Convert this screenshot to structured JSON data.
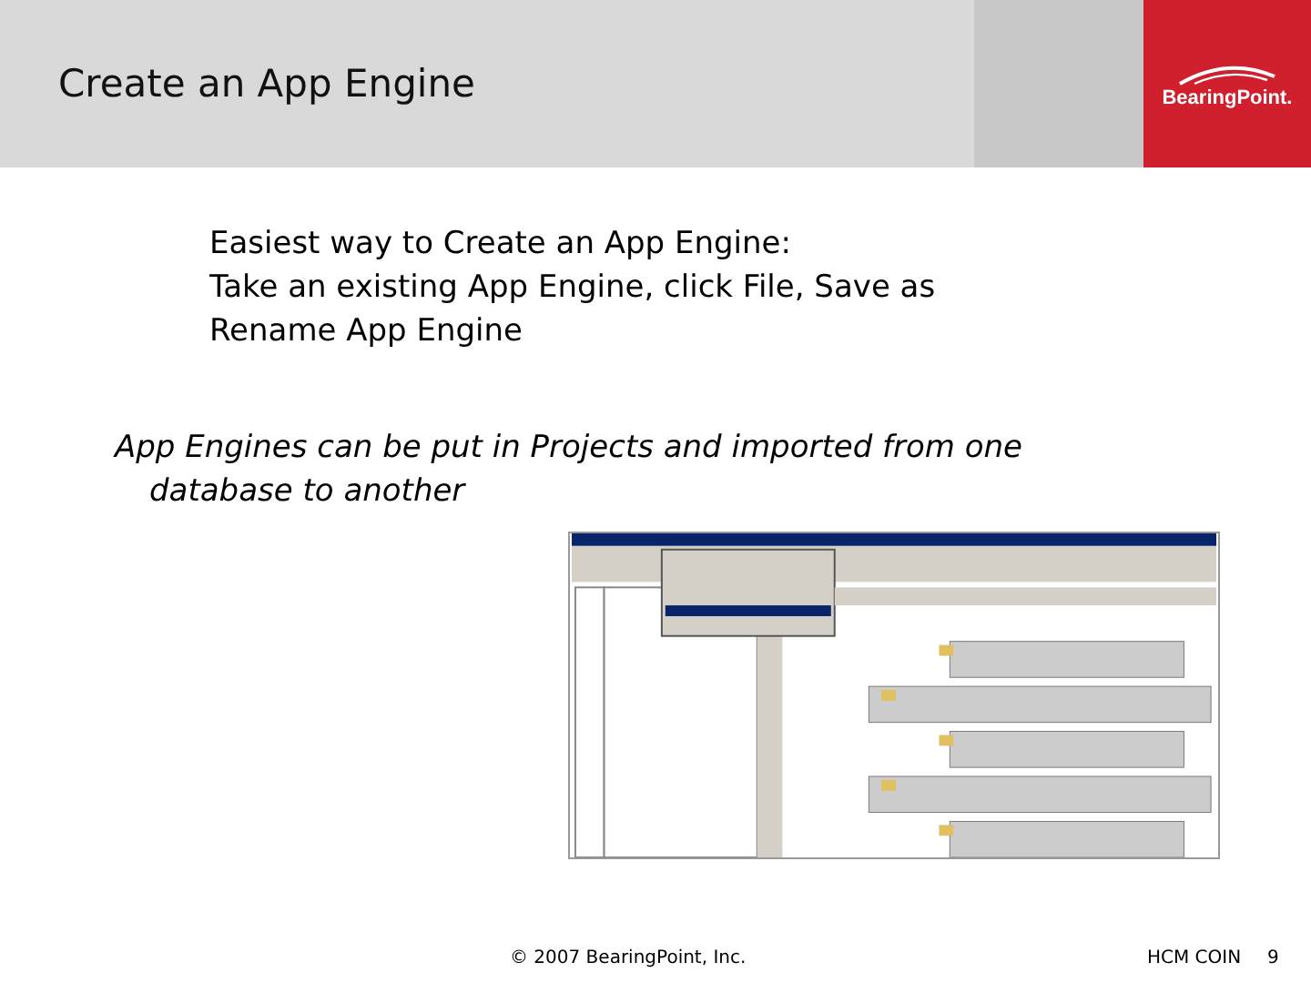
{
  "header": {
    "title": "Create an App Engine",
    "logo": "BearingPoint."
  },
  "bullets": [
    "Easiest way to Create an App Engine:",
    "Take an existing App Engine, click File, Save as",
    "Rename App Engine"
  ],
  "note": "App Engines can be put in Projects and imported from one database to another",
  "footer": {
    "copyright": "© 2007 BearingPoint, Inc.",
    "label": "HCM COIN",
    "page": "9"
  }
}
